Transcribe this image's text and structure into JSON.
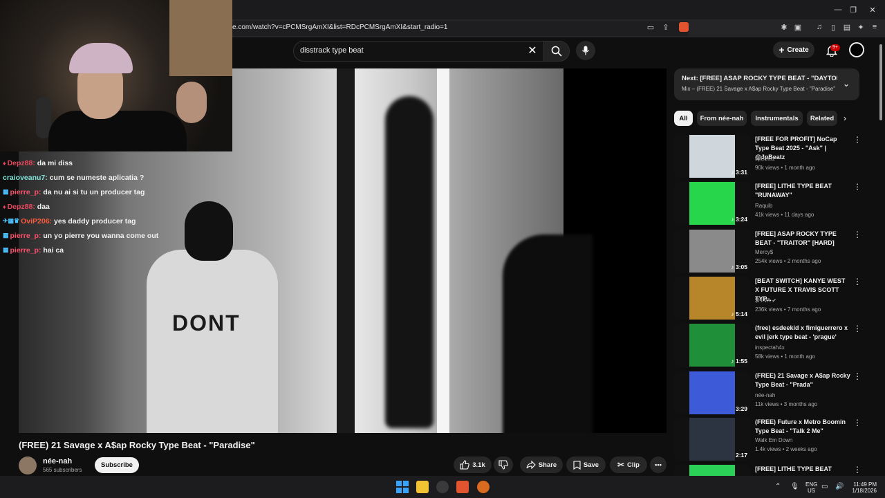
{
  "browser": {
    "url": "e.com/watch?v=cPCMSrgAmXI&list=RDcPCMSrgAmXI&start_radio=1"
  },
  "header": {
    "search_value": "disstrack type beat",
    "create_label": "Create",
    "notifications_count": "9+"
  },
  "overlay": {
    "chat": [
      {
        "badge": "♦",
        "user": "Depz88:",
        "user_color": "#e8465c",
        "message": "da mi diss"
      },
      {
        "badge": "",
        "user": "craioveanu7:",
        "user_color": "#7fe3d9",
        "message": "cum se numeste aplicatia ?"
      },
      {
        "badge": "▦",
        "user": "pierre_p:",
        "user_color": "#ff4f6a",
        "message": "da nu ai si tu un producer tag"
      },
      {
        "badge": "♦",
        "user": "Depz88:",
        "user_color": "#e8465c",
        "message": "daa"
      },
      {
        "badge": "✈▦♛",
        "user": "OviP206:",
        "user_color": "#ff5a3c",
        "message": "yes daddy producer tag"
      },
      {
        "badge": "▦",
        "user": "pierre_p:",
        "user_color": "#ff4f6a",
        "message": "un yo pierre you wanna come out"
      },
      {
        "badge": "▦",
        "user": "pierre_p:",
        "user_color": "#ff4f6a",
        "message": "hai ca"
      }
    ]
  },
  "video": {
    "title": "(FREE) 21 Savage x A$ap Rocky Type Beat - \"Paradise\"",
    "shirt_text": "DONT",
    "channel_name": "née-nah",
    "subscribers": "565 subscribers",
    "subscribe_label": "Subscribe",
    "likes": "3.1k",
    "share_label": "Share",
    "save_label": "Save",
    "clip_label": "Clip"
  },
  "next_up": {
    "title": "Next: [FREE] ASAP ROCKY TYPE BEAT - \"DAYTONA\"...",
    "subtitle": "Mix – (FREE) 21 Savage x A$ap Rocky Type Beat - \"Paradise\""
  },
  "chips": [
    "All",
    "From née-nah",
    "Instrumentals",
    "Related"
  ],
  "recommendations": [
    {
      "title": "[FREE FOR PROFIT] NoCap Type Beat 2025 - \"Ask\" | @JpBeatz",
      "channel": "JpBeatz",
      "meta": "90k views • 1 month ago",
      "duration": "3:31",
      "thumb_color": "#cfd6dc"
    },
    {
      "title": "[FREE] LITHE TYPE BEAT \"RUNAWAY\"",
      "channel": "Raquib",
      "meta": "41k views • 11 days ago",
      "duration": "3:24",
      "thumb_color": "#27d64b"
    },
    {
      "title": "[FREE] ASAP ROCKY TYPE BEAT - \"TRAITOR\" [HARD]",
      "channel": "Mercy$",
      "meta": "254k views • 2 months ago",
      "duration": "3:05",
      "thumb_color": "#8a8a8a"
    },
    {
      "title": "[BEAT SWITCH] KANYE WEST X FUTURE X TRAVIS SCOTT TYP...",
      "channel": "$HIVA",
      "meta": "236k views • 7 months ago",
      "duration": "5:14",
      "thumb_color": "#b8862a"
    },
    {
      "title": "(free) esdeekid x fimiguerrero x evil jerk type beat - 'prague'",
      "channel": "inspectah4x",
      "meta": "58k views • 1 month ago",
      "duration": "1:55",
      "thumb_color": "#1f8f3a"
    },
    {
      "title": "(FREE) 21 Savage x A$ap Rocky Type Beat - \"Prada\"",
      "channel": "née-nah",
      "meta": "11k views • 3 months ago",
      "duration": "3:29",
      "thumb_color": "#3d5bd8"
    },
    {
      "title": "(FREE) Future x Metro Boomin Type Beat - \"Talk 2 Me\"",
      "channel": "Walk Em Down",
      "meta": "1.4k views • 2 weeks ago",
      "duration": "2:17",
      "thumb_color": "#2b3440"
    },
    {
      "title": "[FREE] LITHE TYPE BEAT",
      "channel": "",
      "meta": "",
      "duration": "",
      "thumb_color": "#2ad156"
    }
  ],
  "taskbar": {
    "lang": "ENG",
    "region": "US",
    "time": "11:49 PM",
    "date": "1/18/2026"
  },
  "colors": {
    "accent_red": "#cc0000",
    "background": "#0f0f0f",
    "chip_bg": "#272727"
  }
}
